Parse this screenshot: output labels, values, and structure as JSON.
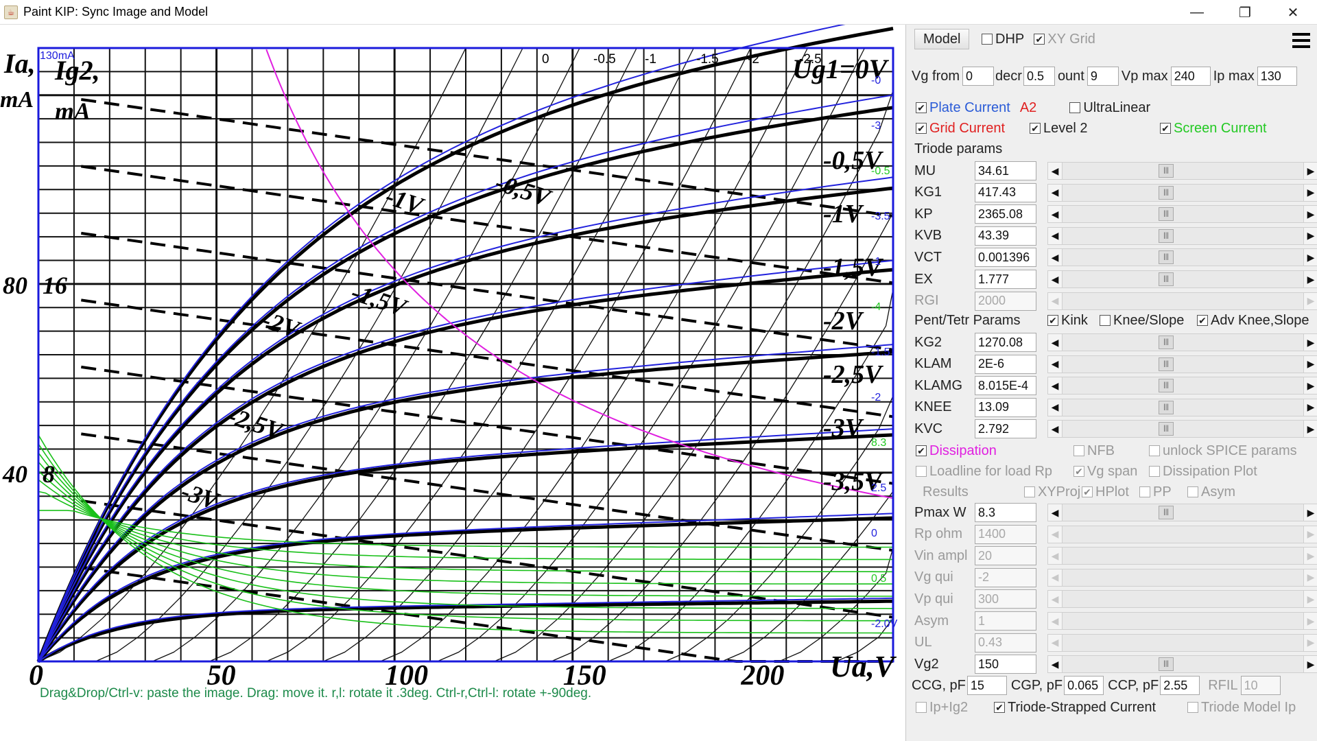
{
  "window": {
    "title": "Paint KIP: Sync Image and Model",
    "minimize": "—",
    "maximize": "❐",
    "close": "✕"
  },
  "canvas": {
    "hint": "Drag&Drop/Ctrl-v: paste the image. Drag: move it. r,l: rotate it .3deg. Ctrl-r,Ctrl-l: rotate +-90deg.",
    "corner_label": "130mA",
    "y_axis_label_1": "Ia,",
    "y_axis_label_2": "mA",
    "y2_axis_label_1": "Ig2,",
    "y2_axis_label_2": "mA",
    "x_axis_label": "Ua,V",
    "top_label": "Ug1=0V",
    "x_ticks": [
      "0",
      "50",
      "100",
      "150",
      "200"
    ],
    "y_ticks_left": [
      "80",
      "40"
    ],
    "y_ticks_left2": [
      "16",
      "8"
    ],
    "top_tick_labels": [
      "0",
      "-0.5",
      "-1",
      "-1.5",
      "-2",
      "-2.5"
    ],
    "curve_labels_right": [
      "-0,5V",
      "-1V",
      "-1,5V",
      "-2V",
      "-2,5V",
      "-3V",
      "-3,5V"
    ],
    "curve_labels_inner": [
      "-0,5V",
      "-1V",
      "-1,5V",
      "-2V",
      "-2,5V",
      "-3V"
    ],
    "model_labels_right": [
      "-0",
      "-3",
      "-0.5",
      "-3.5",
      "-1",
      "-4",
      "-1.5",
      "-2",
      "8.3",
      "2.5",
      "0",
      "0.5",
      "-2.0V"
    ]
  },
  "panel": {
    "model_button": "Model",
    "dhp": {
      "label": "DHP",
      "checked": false
    },
    "xygrid": {
      "label": "XY Grid",
      "checked": true
    },
    "vg_from_label": "Vg from",
    "vg_from": "0",
    "decr_label": "decr",
    "decr": "0.5",
    "count_label": "ount",
    "count": "9",
    "vpmax_label": "Vp max",
    "vpmax": "240",
    "ipmax_label": "Ip max",
    "ipmax": "130",
    "plate_current": {
      "label": "Plate Current",
      "checked": true,
      "color": "#2a5bd7"
    },
    "a2_label": "A2",
    "ultralinear": {
      "label": "UltraLinear",
      "checked": false
    },
    "grid_current": {
      "label": "Grid Current",
      "checked": true,
      "color": "#e02020"
    },
    "level2": {
      "label": "Level 2",
      "checked": true
    },
    "screen_current": {
      "label": "Screen Current",
      "checked": true,
      "color": "#22c922"
    },
    "triode_params_title": "Triode params",
    "triode_params": [
      {
        "name": "MU",
        "value": "34.61",
        "disabled": false
      },
      {
        "name": "KG1",
        "value": "417.43",
        "disabled": false
      },
      {
        "name": "KP",
        "value": "2365.08",
        "disabled": false
      },
      {
        "name": "KVB",
        "value": "43.39",
        "disabled": false
      },
      {
        "name": "VCT",
        "value": "0.001396",
        "disabled": false
      },
      {
        "name": "EX",
        "value": "1.777",
        "disabled": false
      },
      {
        "name": "RGI",
        "value": "2000",
        "disabled": true
      }
    ],
    "pent_title": "Pent/Tetr Params",
    "kink": {
      "label": "Kink",
      "checked": true
    },
    "knee_slope": {
      "label": "Knee/Slope",
      "checked": false
    },
    "adv_knee": {
      "label": "Adv Knee,Slope",
      "checked": true
    },
    "pent_params": [
      {
        "name": "KG2",
        "value": "1270.08",
        "disabled": false
      },
      {
        "name": "KLAM",
        "value": "2E-6",
        "disabled": false
      },
      {
        "name": "KLAMG",
        "value": "8.015E-4",
        "disabled": false
      },
      {
        "name": "KNEE",
        "value": "13.09",
        "disabled": false
      },
      {
        "name": "KVC",
        "value": "2.792",
        "disabled": false
      }
    ],
    "dissipation": {
      "label": "Dissipation",
      "checked": true,
      "color": "#e020e0"
    },
    "nfb": {
      "label": "NFB",
      "checked": false
    },
    "unlock_spice": {
      "label": "unlock SPICE params",
      "checked": false
    },
    "loadline": {
      "label": "Loadline for load Rp",
      "checked": false
    },
    "vg_span": {
      "label": "Vg span",
      "checked": true
    },
    "dissipation_plot": {
      "label": "Dissipation Plot",
      "checked": false
    },
    "results_label": "Results",
    "xyproj": {
      "label": "XYProj",
      "checked": false
    },
    "hplot": {
      "label": "HPlot",
      "checked": true
    },
    "pp": {
      "label": "PP",
      "checked": false
    },
    "asym": {
      "label": "Asym",
      "checked": false
    },
    "load_params": [
      {
        "name": "Pmax W",
        "value": "8.3",
        "disabled": false,
        "name_disabled": false
      },
      {
        "name": "Rp ohm",
        "value": "1400",
        "disabled": true,
        "name_disabled": true
      },
      {
        "name": "Vin ampl",
        "value": "20",
        "disabled": true,
        "name_disabled": true
      },
      {
        "name": "Vg qui",
        "value": "-2",
        "disabled": true,
        "name_disabled": true
      },
      {
        "name": "Vp qui",
        "value": "300",
        "disabled": true,
        "name_disabled": true
      },
      {
        "name": "Asym",
        "value": "1",
        "disabled": true,
        "name_disabled": true
      },
      {
        "name": "UL",
        "value": "0.43",
        "disabled": true,
        "name_disabled": true
      },
      {
        "name": "Vg2",
        "value": "150",
        "disabled": false,
        "name_disabled": false
      }
    ],
    "ccg_label": "CCG, pF",
    "ccg": "15",
    "cgp_label": "CGP, pF",
    "cgp": "0.065",
    "ccp_label": "CCP, pF",
    "ccp": "2.55",
    "rfil_label": "RFIL",
    "rfil": "10",
    "ip_ig2": {
      "label": "Ip+Ig2",
      "checked": false
    },
    "triode_strapped": {
      "label": "Triode-Strapped Current",
      "checked": true
    },
    "triode_model_ip": {
      "label": "Triode Model Ip",
      "checked": false
    }
  }
}
